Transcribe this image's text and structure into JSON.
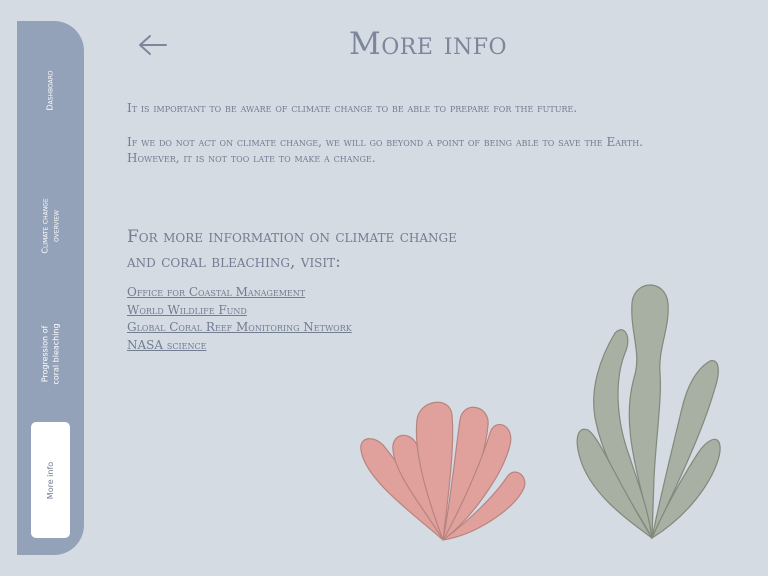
{
  "sidebar": {
    "items": [
      {
        "label": "Dashboard"
      },
      {
        "label": "Climate change overview"
      },
      {
        "label": "Progression of coral bleaching"
      },
      {
        "label": "More info"
      }
    ]
  },
  "header": {
    "back_icon": "arrow-left-icon",
    "title": "More info"
  },
  "content": {
    "paragraph1": "It is important to be aware of climate change to be able to prepare for the future.",
    "paragraph2_line1": "If we do not act on climate change, we will go beyond a point of being able to save the Earth.",
    "paragraph2_line2": "However, it is not too late to make a change.",
    "subheading_line1": "For more information on climate change",
    "subheading_line2": "and coral bleaching, visit:",
    "links": [
      {
        "label": "Office for Coastal Management"
      },
      {
        "label": "World Wildlife Fund"
      },
      {
        "label": "Global Coral Reef Monitoring Network"
      },
      {
        "label": "NASA science"
      }
    ]
  },
  "illustrations": {
    "coral_icon": "coral-icon",
    "seaweed_icon": "seaweed-icon",
    "coral_color": "#e0a19c",
    "seaweed_color": "#a7b0a2"
  },
  "colors": {
    "background": "#d5dbe3",
    "sidebar": "#93a2b8",
    "text": "#727d92"
  }
}
